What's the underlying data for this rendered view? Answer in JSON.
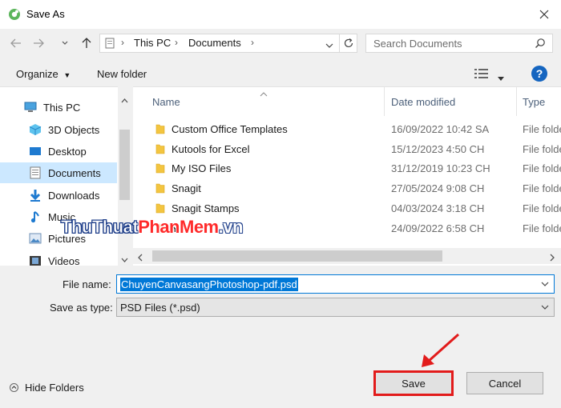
{
  "window": {
    "title": "Save As"
  },
  "address": {
    "crumbs": [
      "This PC",
      "Documents"
    ]
  },
  "search": {
    "placeholder": "Search Documents"
  },
  "toolbar": {
    "organize_label": "Organize",
    "new_folder_label": "New folder",
    "help_label": "?"
  },
  "sidebar": {
    "items": [
      {
        "label": "This PC",
        "icon": "computer-icon"
      },
      {
        "label": "3D Objects",
        "icon": "cube-icon"
      },
      {
        "label": "Desktop",
        "icon": "desktop-icon"
      },
      {
        "label": "Documents",
        "icon": "document-icon",
        "selected": true
      },
      {
        "label": "Downloads",
        "icon": "download-arrow-icon"
      },
      {
        "label": "Music",
        "icon": "music-note-icon"
      },
      {
        "label": "Pictures",
        "icon": "picture-icon"
      },
      {
        "label": "Videos",
        "icon": "film-icon"
      }
    ]
  },
  "filelist": {
    "columns": {
      "name": "Name",
      "date": "Date modified",
      "type": "Type"
    },
    "rows": [
      {
        "name": "Custom Office Templates",
        "date": "16/09/2022 10:42 SA",
        "type": "File folder"
      },
      {
        "name": "Kutools for Excel",
        "date": "15/12/2023 4:50 CH",
        "type": "File folder"
      },
      {
        "name": "My ISO Files",
        "date": "31/12/2019 10:23 CH",
        "type": "File folder"
      },
      {
        "name": "Snagit",
        "date": "27/05/2024 9:08 CH",
        "type": "File folder"
      },
      {
        "name": "Snagit Stamps",
        "date": "04/03/2024 3:18 CH",
        "type": "File folder"
      },
      {
        "name": "Y",
        "date": "24/09/2022 6:58 CH",
        "type": "File folder"
      }
    ]
  },
  "form": {
    "filename_label": "File name:",
    "filename_value": "ChuyenCanvasangPhotoshop-pdf.psd",
    "savetype_label": "Save as type:",
    "savetype_value": "PSD Files (*.psd)"
  },
  "footer": {
    "hide_folders_label": "Hide Folders",
    "save_label": "Save",
    "cancel_label": "Cancel"
  },
  "watermark": {
    "part1": "ThuThuat",
    "part2": "PhanMem",
    "part3": ".vn"
  },
  "colors": {
    "accent": "#0078d7",
    "highlight": "#e21b1b",
    "selected_bg": "#cce8ff"
  }
}
